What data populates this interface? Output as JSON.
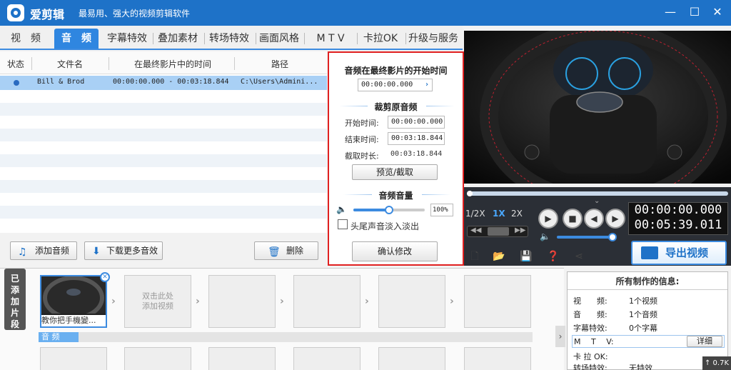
{
  "app": {
    "name": "爱剪辑",
    "slogan": "最易用、强大的视频剪辑软件"
  },
  "window": {
    "min": "—",
    "max": "☐",
    "close": "✕"
  },
  "tabs": [
    {
      "label": "视　频"
    },
    {
      "label": "音　频"
    },
    {
      "label": "字幕特效"
    },
    {
      "label": "叠加素材"
    },
    {
      "label": "转场特效"
    },
    {
      "label": "画面风格"
    },
    {
      "label": "M T V"
    },
    {
      "label": "卡拉OK"
    },
    {
      "label": "升级与服务"
    }
  ],
  "table": {
    "headers": [
      "状态",
      "文件名",
      "在最终影片中的时间",
      "路径"
    ],
    "row": {
      "name": "Bill & Brod",
      "time": "00:00:00.000 - 00:03:18.844",
      "path": "C:\\Users\\Admini..."
    }
  },
  "buttons": {
    "add_audio": "添加音频",
    "download_more": "下载更多音效",
    "delete": "删除"
  },
  "panel": {
    "start_title": "音频在最终影片的开始时间",
    "start_value": "00:00:00.000",
    "trim_title": "裁剪原音频",
    "start_label": "开始时间:",
    "start_time": "00:00:00.000",
    "end_label": "结束时间:",
    "end_time": "00:03:18.844",
    "dur_label": "截取时长:",
    "dur_value": "00:03:18.844",
    "preview_btn": "预览/截取",
    "volume_title": "音频音量",
    "volume_value": "100%",
    "volume_level": 1.0,
    "fade_label": "头尾声音淡入淡出",
    "confirm": "确认修改"
  },
  "player": {
    "speed": [
      "1/2X",
      "1X",
      "2X"
    ],
    "time_current": "00:00:00.000",
    "time_total": "00:05:39.011",
    "export": "导出视频"
  },
  "timeline": {
    "side_label": "已添加片段",
    "clip_caption": "教你把手機變...",
    "empty_hint": "双击此处\n添加视频",
    "audio_track": "音 频"
  },
  "info": {
    "title": "所有制作的信息:",
    "rows": [
      {
        "k": "视　　频:",
        "v": "1个视频"
      },
      {
        "k": "音　　频:",
        "v": "1个音频"
      },
      {
        "k": "字幕特效:",
        "v": "0个字幕"
      },
      {
        "k": "M　 T　 V:",
        "v": ""
      },
      {
        "k": "卡 拉 OK:",
        "v": ""
      },
      {
        "k": "转场特效:",
        "v": "无特效"
      }
    ],
    "detail_btn": "详细"
  },
  "network": "0.7K",
  "colors": {
    "brand": "#1e72c8",
    "highlight": "#e02020",
    "selected": "#a9d0f5"
  }
}
